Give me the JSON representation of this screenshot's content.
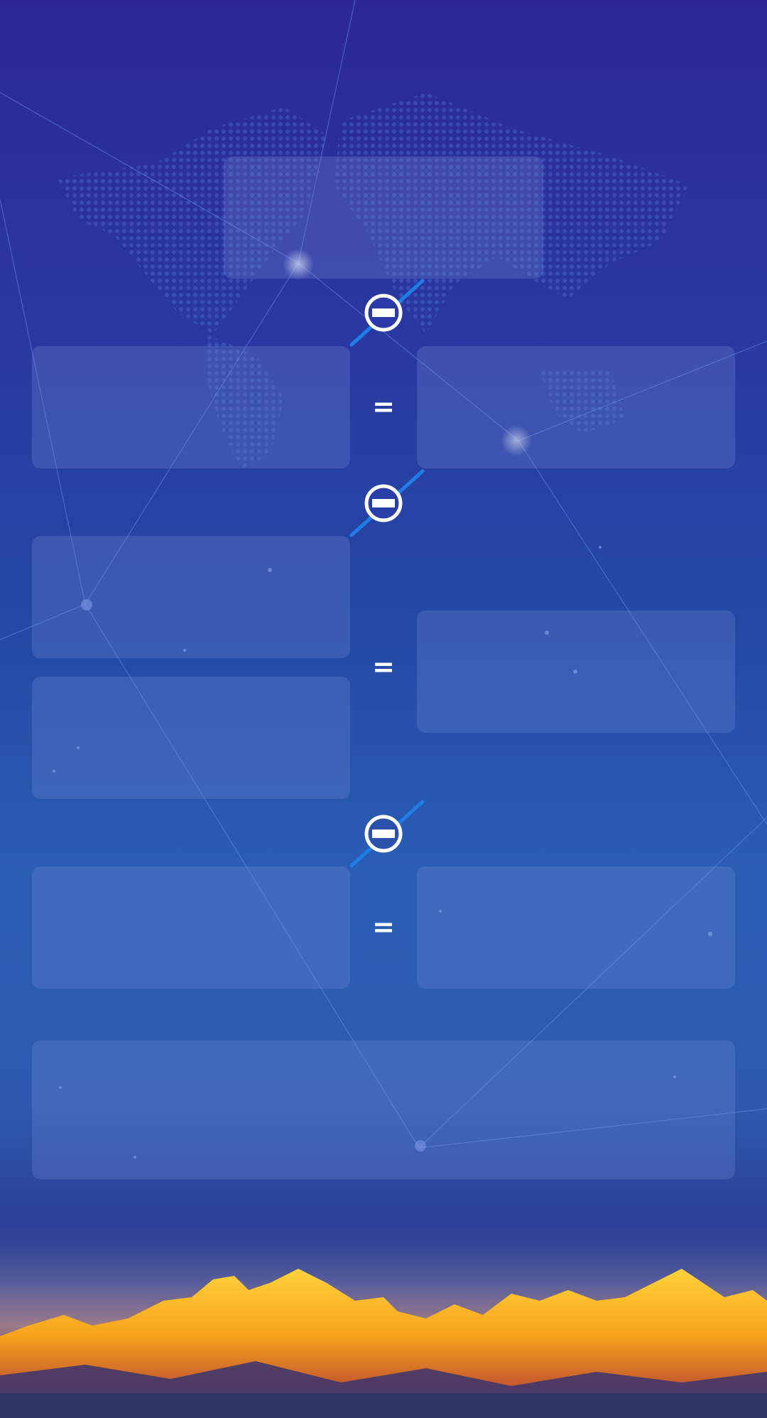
{
  "screen": {
    "description_of_state": "",
    "equations": [
      {
        "operator": "minus-icon",
        "relation": "="
      },
      {
        "operator": "minus-icon",
        "relation": "="
      },
      {
        "operator": "minus-icon",
        "relation": "="
      }
    ],
    "colors": {
      "background_top": "#2c2795",
      "background_mid": "#2a5eb5",
      "panel_fill": "rgba(120,140,215,0.28)",
      "operator_stroke": "#ffffff",
      "operator_slash": "#1f7de8",
      "mountain_glow": "#f6a21b"
    },
    "eq_symbol": "="
  }
}
